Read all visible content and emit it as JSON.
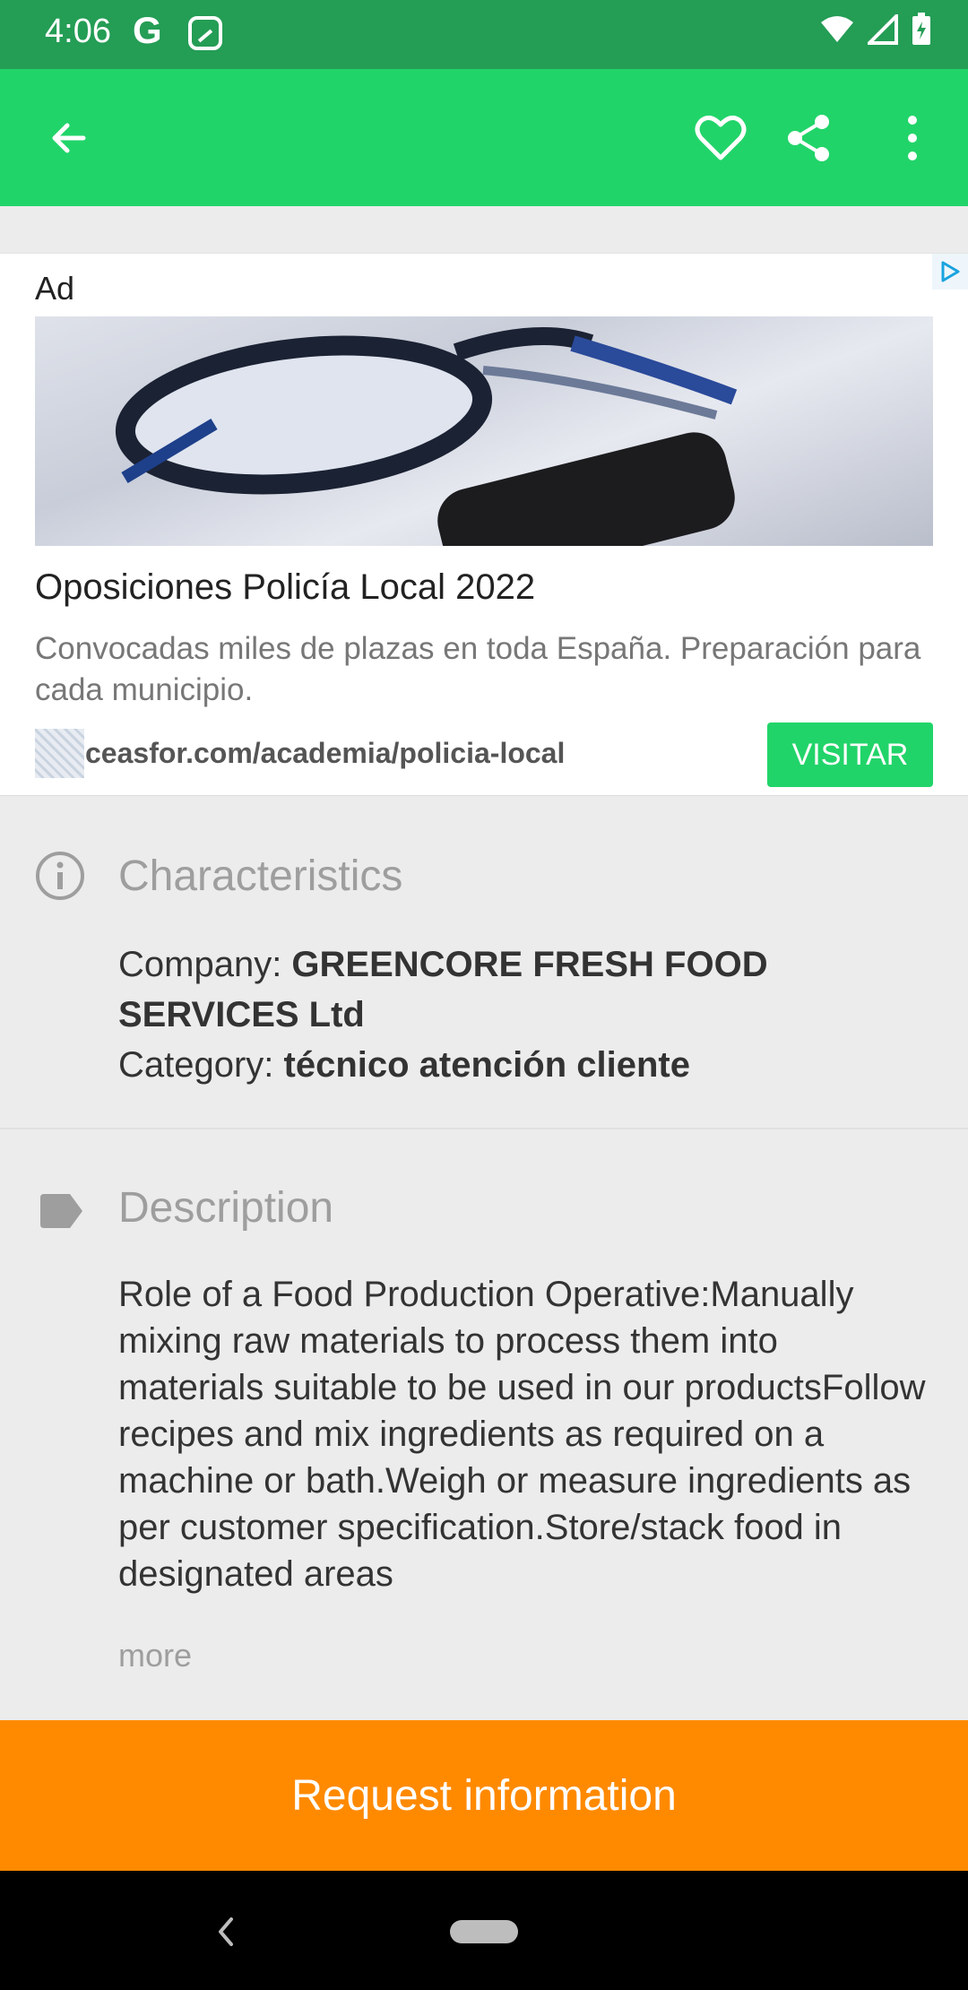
{
  "status_bar": {
    "time": "4:06",
    "google_icon": "google-g-icon",
    "photo_icon": "photo-notification-icon",
    "wifi_icon": "wifi-icon",
    "signal_icon": "signal-icon",
    "battery_icon": "battery-charging-icon"
  },
  "app_bar": {
    "background": "#21d469",
    "back_icon": "arrow-back-icon",
    "favorite_icon": "heart-outline-icon",
    "share_icon": "share-icon",
    "menu_icon": "more-vert-icon"
  },
  "ad": {
    "label": "Ad",
    "title": "Oposiciones Policía Local 2022",
    "description": "Convocadas miles de plazas en toda España. Preparación para cada municipio.",
    "url": "ceasfor.com/academia/policia-local",
    "cta": "VISITAR",
    "cta_color": "#21d469"
  },
  "characteristics": {
    "title": "Characteristics",
    "company_label": "Company: ",
    "company_value": "GREENCORE FRESH FOOD SERVICES Ltd",
    "category_label": "Category: ",
    "category_value": "técnico atención cliente"
  },
  "description": {
    "title": "Description",
    "text": "Role of a Food Production Operative:Manually mixing raw materials to process them into materials suitable to be used in our productsFollow recipes and mix ingredients as required on a machine or bath.Weigh or measure ingredients as per customer specification.Store/stack food in designated areas",
    "more": "more"
  },
  "request_button": {
    "label": "Request information",
    "color": "#ff8a00"
  }
}
